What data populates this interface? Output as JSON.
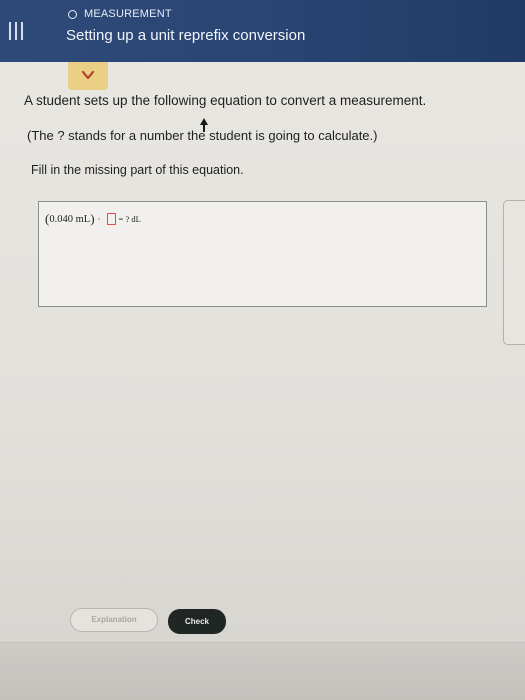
{
  "header": {
    "topic": "MEASUREMENT",
    "lesson_title": "Setting up a unit reprefix conversion",
    "background_color": "#2b4675"
  },
  "icons": {
    "menu": "hamburger-menu-icon",
    "topic_dot": "circle-icon",
    "expand": "chevron-down-icon",
    "cursor": "mouse-cursor-icon"
  },
  "question": {
    "line1": "A student sets up the following equation to convert a measurement.",
    "line2": "(The ? stands for a number the student is going to calculate.)",
    "line3": "Fill in the missing part of this equation."
  },
  "equation": {
    "open_paren": "(",
    "value": "0.040 mL",
    "close_paren": ")",
    "dot": "·",
    "equals": "= ? dL",
    "missing_box_color": "#e0504a"
  },
  "buttons": {
    "explanation": "Explanation",
    "check": "Check"
  }
}
